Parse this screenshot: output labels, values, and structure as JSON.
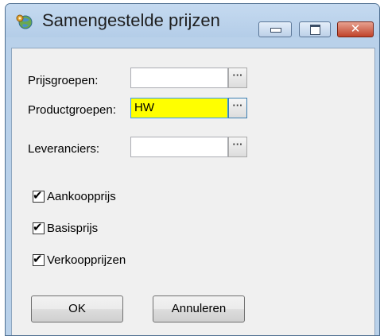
{
  "window": {
    "title": "Samengestelde prijzen",
    "controls": {
      "close_glyph": "✕"
    }
  },
  "fields": {
    "prijsgroepen": {
      "label": "Prijsgroepen:",
      "value": "",
      "browse": "···"
    },
    "productgroepen": {
      "label": "Productgroepen:",
      "value": "HW",
      "browse": "···",
      "highlight_color": "#ffff00"
    },
    "leveranciers": {
      "label": "Leveranciers:",
      "value": "",
      "browse": "···"
    }
  },
  "checkboxes": [
    {
      "label": "Aankoopprijs",
      "checked": true
    },
    {
      "label": "Basisprijs",
      "checked": true
    },
    {
      "label": "Verkoopprijzen",
      "checked": true
    }
  ],
  "buttons": {
    "ok": "OK",
    "cancel": "Annuleren"
  },
  "icons": {
    "app": "globe-gear-icon",
    "checkmark": "✔"
  }
}
